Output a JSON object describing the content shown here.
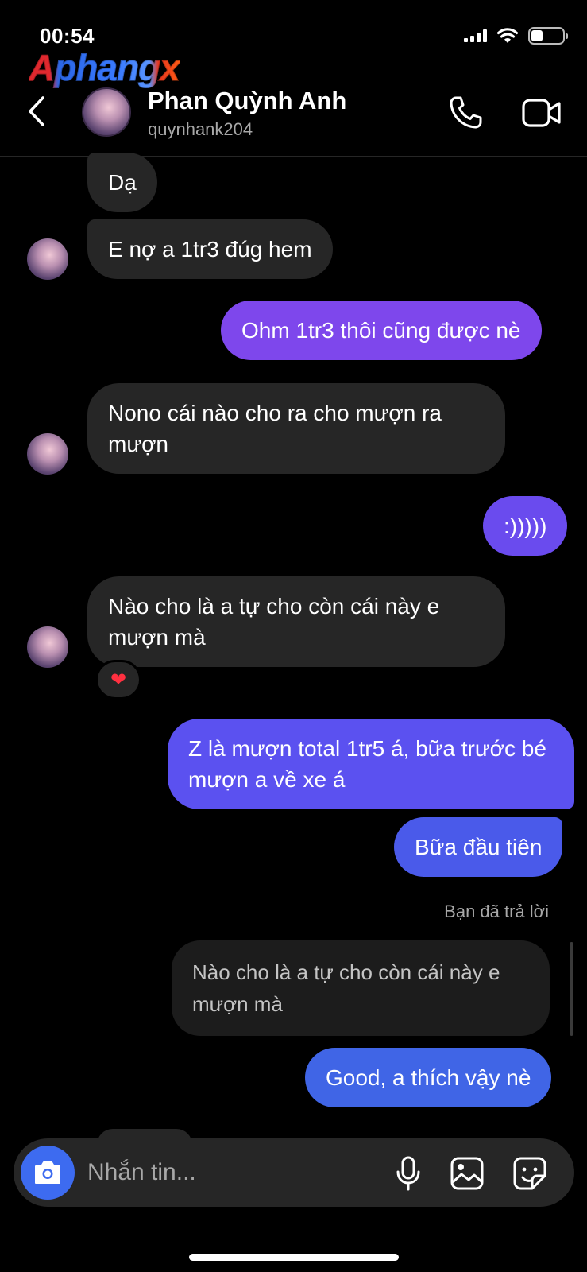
{
  "status_bar": {
    "time": "00:54",
    "battery_percent": 38
  },
  "watermark": "Aphangx",
  "header": {
    "contact_name": "Phan Quỳnh Anh",
    "username": "quynhank204",
    "icons": {
      "back": "chevron-left-icon",
      "call": "phone-icon",
      "video": "video-camera-icon"
    }
  },
  "messages": [
    {
      "id": "m1",
      "from": "them",
      "text": "Dạ"
    },
    {
      "id": "m2",
      "from": "them",
      "text": "E nợ a 1tr3 đúg hem"
    },
    {
      "id": "m3",
      "from": "me",
      "text": "Ohm 1tr3 thôi cũng được nè"
    },
    {
      "id": "m4",
      "from": "them",
      "text": "Nono cái nào cho ra cho mượn ra mượn"
    },
    {
      "id": "m5",
      "from": "me",
      "text": ":)))))"
    },
    {
      "id": "m6",
      "from": "them",
      "text": "Nào cho là a tự cho còn cái này e mượn mà",
      "reaction": "❤"
    },
    {
      "id": "m7",
      "from": "me",
      "text": "Z là mượn total 1tr5 á, bữa trước bé mượn a về xe á"
    },
    {
      "id": "m8",
      "from": "me",
      "text": "Bữa đầu tiên"
    }
  ],
  "reply": {
    "label": "Bạn đã trả lời",
    "quoted_text": "Nào cho là a tự cho còn cái này e mượn mà",
    "text": "Good, a thích vậy nè"
  },
  "composer": {
    "placeholder": "Nhắn tin...",
    "icons": [
      "camera-icon",
      "microphone-icon",
      "gallery-icon",
      "sticker-icon"
    ]
  },
  "colors": {
    "background": "#000000",
    "received_bubble": "#262626",
    "sent_gradient_start": "#8a45ec",
    "sent_gradient_mid": "#5a4ff0",
    "sent_gradient_end": "#3d6ae6",
    "camera_button": "#3d6bf0",
    "reaction_heart": "#ff3040"
  }
}
